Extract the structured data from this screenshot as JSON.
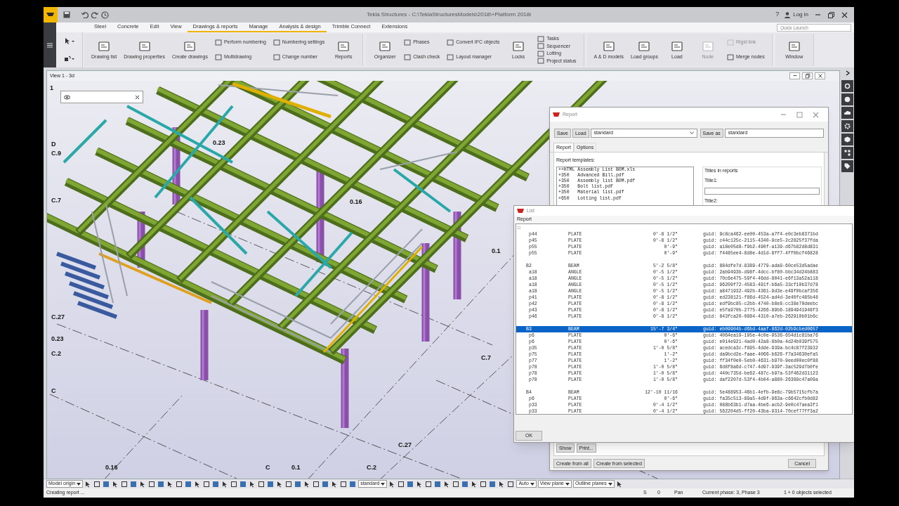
{
  "app": {
    "title": "Tekla Structures - C:\\TeklaStructuresModels\\2018\\+Platform 2018i",
    "help": "?",
    "login": "Log in",
    "quick_launch": {
      "placeholder": "Quick Launch"
    }
  },
  "ribbon_tabs": [
    {
      "label": "Steel",
      "underlined": false
    },
    {
      "label": "Concrete",
      "underlined": false
    },
    {
      "label": "Edit",
      "underlined": false
    },
    {
      "label": "View",
      "underlined": false
    },
    {
      "label": "Drawings & reports",
      "underlined": true
    },
    {
      "label": "Manage",
      "underlined": true
    },
    {
      "label": "Analysis & design",
      "underlined": true
    },
    {
      "label": "Trimble Connect",
      "underlined": false
    },
    {
      "label": "Extensions",
      "underlined": false
    }
  ],
  "ribbon_groups": [
    {
      "items": [
        {
          "kind": "large",
          "label": "Drawing list",
          "disabled": false
        },
        {
          "kind": "large",
          "label": "Drawing properties",
          "disabled": false
        },
        {
          "kind": "large",
          "label": "Create drawings",
          "disabled": false
        },
        {
          "kind": "stack",
          "items": [
            {
              "label": "Perform numbering",
              "disabled": false
            },
            {
              "label": "Multidrawing",
              "disabled": false
            }
          ]
        },
        {
          "kind": "stack",
          "items": [
            {
              "label": "Numbering settings",
              "disabled": false
            },
            {
              "label": "Change number",
              "disabled": false
            }
          ]
        },
        {
          "kind": "large",
          "label": "Reports",
          "disabled": false
        }
      ]
    },
    {
      "items": [
        {
          "kind": "large",
          "label": "Organizer",
          "disabled": false
        },
        {
          "kind": "stack",
          "items": [
            {
              "label": "Phases",
              "disabled": false
            },
            {
              "label": "Clash check",
              "disabled": false
            }
          ]
        },
        {
          "kind": "stack",
          "items": [
            {
              "label": "Convert IFC objects",
              "disabled": false
            },
            {
              "label": "Layout manager",
              "disabled": false
            }
          ]
        },
        {
          "kind": "large",
          "label": "Locks",
          "disabled": false
        },
        {
          "kind": "stack",
          "items": [
            {
              "label": "Tasks",
              "disabled": false
            },
            {
              "label": "Sequencer",
              "disabled": false
            },
            {
              "label": "Lotting",
              "disabled": false
            },
            {
              "label": "Project status",
              "disabled": false
            }
          ]
        }
      ]
    },
    {
      "items": [
        {
          "kind": "large",
          "label": "A & D models",
          "disabled": false
        },
        {
          "kind": "large",
          "label": "Load groups",
          "disabled": false
        },
        {
          "kind": "large",
          "label": "Load",
          "disabled": false
        },
        {
          "kind": "large",
          "label": "Node",
          "disabled": true
        },
        {
          "kind": "stack",
          "items": [
            {
              "label": "Rigid link",
              "disabled": true
            },
            {
              "label": "Merge nodes",
              "disabled": false
            }
          ]
        }
      ]
    },
    {
      "items": [
        {
          "kind": "large",
          "label": "Window",
          "disabled": false
        }
      ]
    }
  ],
  "view": {
    "title": "View 1 - 3d",
    "grid_labels": [
      "1",
      "D",
      "C.9",
      "0.23",
      "C.7",
      "0.16",
      "0.1",
      "C.27",
      "0.23",
      "C.2",
      "C.7",
      "C",
      "C.27",
      "0.16",
      "C",
      "0.1",
      "C.2"
    ]
  },
  "report_dialog": {
    "title": "Report",
    "save": "Save",
    "load": "Load",
    "settings_value": "standard",
    "save_as": "Save as",
    "save_as_value": "standard",
    "tabs": [
      {
        "label": "Report",
        "selected": true
      },
      {
        "label": "Options",
        "selected": false
      }
    ],
    "templates_label": "Report templates:",
    "templates": [
      "++HTML Assembly List BOM.xls",
      "+350   Advanced Bill.pdf",
      "+350   Assembly list BOM.pdf",
      "+350   Bolt list.pdf",
      "+350   Material list.pdf",
      "+650   Lotting list.pdf"
    ],
    "titles_group": "Titles in reports",
    "title1_label": "Title1:",
    "title2_label": "Title2:",
    "show": "Show",
    "print": "Print...",
    "create_all": "Create from all",
    "create_selected": "Create from selected",
    "cancel": "Cancel"
  },
  "list_dialog": {
    "title": "List",
    "menu": "Report",
    "first_line": "□",
    "groups": [
      {
        "rows": [
          {
            "mark": "p44",
            "type": "PLATE",
            "length": "0'-8 1/2\"",
            "guid": "guid: 9c8ca462-ee00-453a-a7f4-e0c3eb8371bd",
            "selected": false
          },
          {
            "mark": "p45",
            "type": "PLATE",
            "length": "0'-8 1/2\"",
            "guid": "guid: c44c125c-2115-4340-9ce5-2c2825f37fda",
            "selected": false
          },
          {
            "mark": "p55",
            "type": "PLATE",
            "length": "0'-9\"",
            "guid": "guid: a18e05d8-f9b2-490f-a139-d67b82d8d831",
            "selected": false
          },
          {
            "mark": "p55",
            "type": "PLATE",
            "length": "0'-9\"",
            "guid": "guid: f4485ee4-8d8e-4d1d-8ff7-4ff0bcf46828",
            "selected": false
          }
        ]
      },
      {
        "rows": [
          {
            "mark": "B2",
            "type": "BEAM",
            "length": "5'-2 5/8\"",
            "guid": "guid: 884dfe7d-8389-4779-ada9-60ce53d5adae",
            "selected": false
          },
          {
            "mark": "a18",
            "type": "ANGLE",
            "length": "0'-5 1/2\"",
            "guid": "guid: 2ab9493b-d98f-4dcc-bf80-bbc34d24b883",
            "selected": false
          },
          {
            "mark": "a18",
            "type": "ANGLE",
            "length": "0'-5 1/2\"",
            "guid": "guid: 70c6e475-59f4-46dd-8041-e6f13a52a118",
            "selected": false
          },
          {
            "mark": "a18",
            "type": "ANGLE",
            "length": "0'-5 1/2\"",
            "guid": "guid: 96209f72-4583-491f-b6a5-33cf10b37d78",
            "selected": false
          },
          {
            "mark": "a18",
            "type": "ANGLE",
            "length": "0'-5 1/2\"",
            "guid": "guid: a8471932-492b-4361-9d3e-e49f0bcaf356",
            "selected": false
          },
          {
            "mark": "p41",
            "type": "PLATE",
            "length": "0'-8 1/2\"",
            "guid": "guid: ed238121-f86d-4524-ad4d-3e40fc485b48",
            "selected": false
          },
          {
            "mark": "p42",
            "type": "PLATE",
            "length": "0'-8 1/2\"",
            "guid": "guid: edf9bc85-c2bb-4740-b8e8-cc38e70deebc",
            "selected": false
          },
          {
            "mark": "p43",
            "type": "PLATE",
            "length": "0'-8 1/2\"",
            "guid": "guid: e5fa970b-2775-4266-89b6-1894941948f3",
            "selected": false
          },
          {
            "mark": "p46",
            "type": "PLATE",
            "length": "0'-8 1/2\"",
            "guid": "guid: 843fca20-0984-4310-a7eb-262910b01b6c",
            "selected": false
          }
        ]
      },
      {
        "rows": [
          {
            "mark": "B3",
            "type": "BEAM",
            "length": "15'-7 3/4\"",
            "guid": "guid: eb09904b-d6bd-4aaf-862d-02b9cbed0657",
            "selected": true
          },
          {
            "mark": "p6",
            "type": "PLATE",
            "length": "0'-6\"",
            "guid": "guid: 4064ea19-195e-4c0e-9536-654d1c81ba76",
            "selected": false
          },
          {
            "mark": "p6",
            "type": "PLATE",
            "length": "0'-6\"",
            "guid": "guid: e014e921-4ad0-42a8-8b0a-4d24b039f575",
            "selected": false
          },
          {
            "mark": "p35",
            "type": "PLATE",
            "length": "1'-0 5/8\"",
            "guid": "guid: acedca3c-f895-4dde-939a-bc4c87f23932",
            "selected": false
          },
          {
            "mark": "p75",
            "type": "PLATE",
            "length": "1'-2\"",
            "guid": "guid: da9bcd2e-faae-4066-b626-f7a34630efa5",
            "selected": false
          },
          {
            "mark": "p77",
            "type": "PLATE",
            "length": "1'-2\"",
            "guid": "guid: ff34f0e0-5eb0-4631-b970-9eed00ec0f88",
            "selected": false
          },
          {
            "mark": "p78",
            "type": "PLATE",
            "length": "1'-0 5/8\"",
            "guid": "guid: 6d8f8a6d-c747-4d97-939f-3ac529d7b0fe",
            "selected": false
          },
          {
            "mark": "p78",
            "type": "PLATE",
            "length": "1'-0 5/8\"",
            "guid": "guid: 440c735d-be62-487c-b97a-53f462d31123",
            "selected": false
          },
          {
            "mark": "p78",
            "type": "PLATE",
            "length": "1'-0 5/8\"",
            "guid": "guid: daf2207d-53f4-4b04-a880-26399c47a09a",
            "selected": false
          }
        ]
      },
      {
        "rows": [
          {
            "mark": "B4",
            "type": "BEAM",
            "length": "12'-10 11/16",
            "guid": "guid: 5e488953-46b1-4efb-9e8c-79b5715cfb7a",
            "selected": false
          },
          {
            "mark": "p6",
            "type": "PLATE",
            "length": "0'-6\"",
            "guid": "guid: fa35c513-89a5-4d9f-963a-c6642cfb0d82",
            "selected": false
          },
          {
            "mark": "p33",
            "type": "PLATE",
            "length": "0'-4 1/2\"",
            "guid": "guid: 088b63b1-d7aa-4be6-acb2-9e0c47aea3f1",
            "selected": false
          },
          {
            "mark": "p33",
            "type": "PLATE",
            "length": "0'-4 1/2\"",
            "guid": "guid: 562204d5-ff20-43ba-9314-70cef77ff3a2",
            "selected": false
          }
        ]
      }
    ],
    "ok": "OK"
  },
  "bottom_toolbar": {
    "dropdowns": [
      "Model origin",
      "standard",
      "Auto",
      "View plane",
      "Outline planes"
    ]
  },
  "status_bar": {
    "message": "Creating report ...",
    "snap": "S",
    "count": "0",
    "mode": "Pan",
    "phase": "Current phase: 3, Phase 3",
    "selection": "1 + 0 objects selected"
  }
}
